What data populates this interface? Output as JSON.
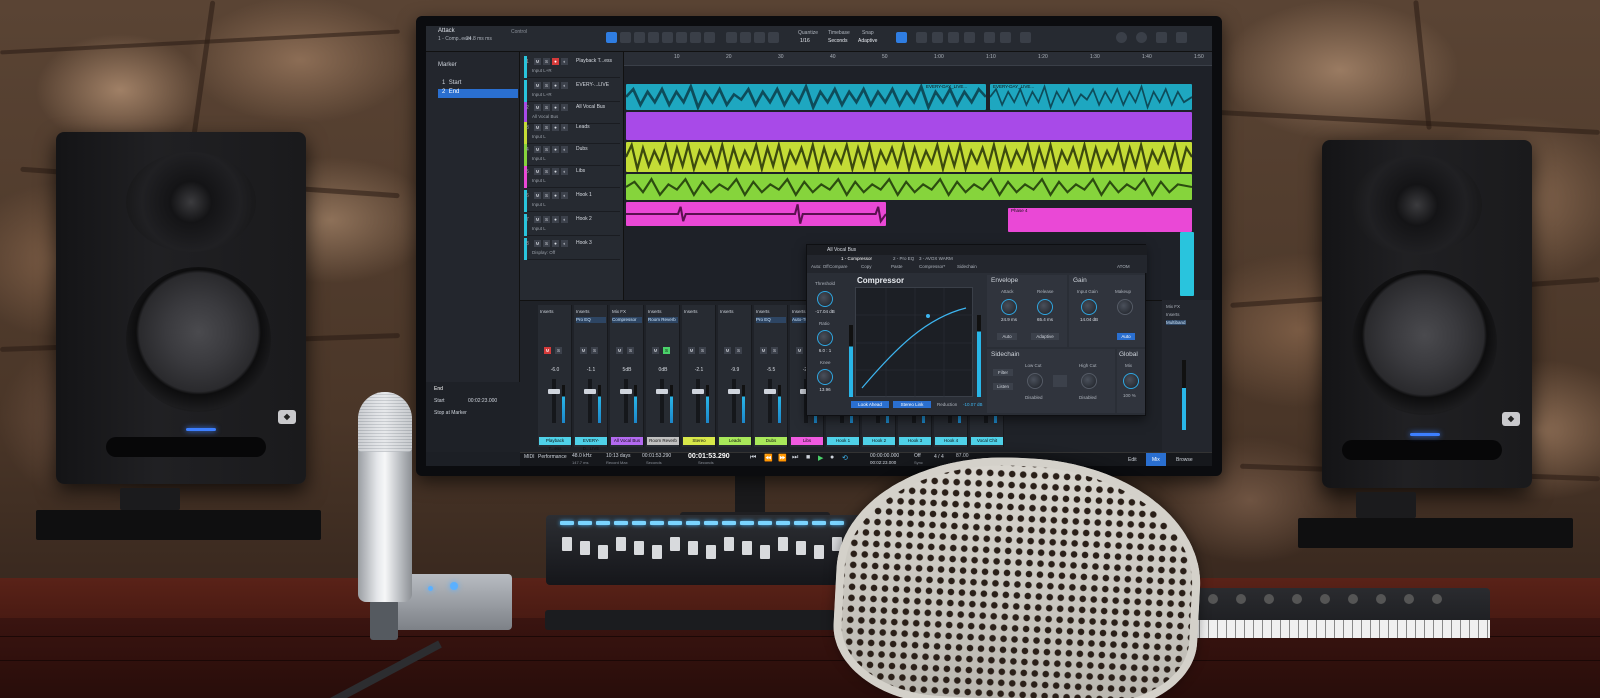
{
  "daw": {
    "song_title": "Attack",
    "song_sub": "1 - Comp..eeer",
    "song_sub2": "24.8 ms ms",
    "control_label": "Control",
    "quantize_label": "Quantize",
    "quantize_val": "1/16",
    "timebase_label": "Timebase",
    "timebase_val": "Seconds",
    "snap_label": "Snap",
    "snap_val": "Adaptive",
    "marker_title": "Marker",
    "markers": [
      {
        "num": "1",
        "name": "Start"
      },
      {
        "num": "2",
        "name": "End"
      }
    ],
    "marker_end_label": "End",
    "marker_start_label": "Start",
    "marker_start_val": "00:02:23.000",
    "stop_at_marker": "Stop at Marker",
    "ruler": [
      "10",
      "20",
      "30",
      "40",
      "50",
      "1:00",
      "1:10",
      "1:20",
      "1:30",
      "1:40",
      "1:50"
    ],
    "tracks": [
      {
        "num": "1",
        "name": "Playback T...ess",
        "input": "Input L+R"
      },
      {
        "num": "",
        "name": "EVERY-...LIVE",
        "input": "Input L+R"
      },
      {
        "num": "2",
        "name": "All Vocal Bus",
        "input": "All Vocal Bus"
      },
      {
        "num": "3",
        "name": "Leads",
        "input": "Input L"
      },
      {
        "num": "4",
        "name": "Dubs",
        "input": "Input L"
      },
      {
        "num": "5",
        "name": "Libs",
        "input": "Input L"
      },
      {
        "num": "6",
        "name": "Hook 1",
        "input": "Input L"
      },
      {
        "num": "7",
        "name": "Hook 2",
        "input": "Input L"
      },
      {
        "num": "8",
        "name": "Hook 3",
        "input": "Display: Off"
      }
    ],
    "clip_labels": [
      "EVERY-DAY_LIVE...",
      "EVERY-DAY_LIVE...",
      "Phase 4"
    ],
    "mixer_strips": [
      {
        "name": "Playback T...ess",
        "insert": "Inserts",
        "plugin": "",
        "val": "-6.0",
        "color": "#4fd1e8"
      },
      {
        "name": "EVERY-D...LIVE",
        "insert": "Inserts",
        "plugin": "Pro EQ",
        "val": "-1.1",
        "color": "#4fd1e8"
      },
      {
        "name": "All Vocal Bus",
        "insert": "Mix FX",
        "plugin": "Compressor",
        "val": "5dB",
        "color": "#b36af0"
      },
      {
        "name": "Room Reverb",
        "insert": "Inserts",
        "plugin": "Room Reverb",
        "val": "0dB",
        "color": "#c0c0c0"
      },
      {
        "name": "Stereo",
        "insert": "Inserts",
        "plugin": "",
        "val": "-2.1",
        "color": "#d8e84a"
      },
      {
        "name": "Leads",
        "insert": "Inserts",
        "plugin": "",
        "val": "-9.9",
        "color": "#a8e85a"
      },
      {
        "name": "Dubs",
        "insert": "Inserts",
        "plugin": "Pro EQ",
        "val": "-5.5",
        "color": "#a8e85a"
      },
      {
        "name": "Libs",
        "insert": "Inserts",
        "plugin": "Auto-Tune",
        "val": "-2.8",
        "color": "#f05ae0"
      },
      {
        "name": "Hook 1",
        "insert": "Inserts",
        "plugin": "Compre...",
        "val": "-6.0",
        "color": "#4fd1e8"
      },
      {
        "name": "Hook 2",
        "insert": "Inserts",
        "plugin": "",
        "val": "-3.2",
        "color": "#4fd1e8"
      },
      {
        "name": "Hook 3",
        "insert": "Inserts",
        "plugin": "",
        "val": "-4.0",
        "color": "#4fd1e8"
      },
      {
        "name": "Hook 4",
        "insert": "Inserts",
        "plugin": "",
        "val": "-2.9",
        "color": "#4fd1e8"
      },
      {
        "name": "Vocal Chit",
        "insert": "Inserts",
        "plugin": "",
        "val": "-1.5",
        "color": "#4fd1e8"
      }
    ],
    "plugin": {
      "bus": "All Vocal Bus",
      "tabs": [
        "1 - Compressor",
        "2 - Pro EQ",
        "3 - AVOX WARM"
      ],
      "sidechain_label": "Sidechain",
      "preset": "Compressor*",
      "auto_off": "Auto: Off",
      "compare": "Compare",
      "copy": "Copy",
      "paste": "Paste",
      "atom": "ATOM",
      "title": "Compressor",
      "threshold_label": "Threshold",
      "threshold_val": "-17.04 dB",
      "ratio_label": "Ratio",
      "ratio_val": "6.0 : 1",
      "knee_label": "Knee",
      "knee_val": "13.96",
      "envelope_label": "Envelope",
      "attack_label": "Attack",
      "attack_val": "24.9 ms",
      "release_label": "Release",
      "release_val": "65.4 ms",
      "auto_btn": "Auto",
      "adaptive_btn": "Adaptive",
      "gain_label": "Gain",
      "input_gain_label": "Input Gain",
      "input_gain_val": "14.04 dB",
      "makeup_label": "Makeup",
      "makeup_auto": "Auto",
      "sc_label": "Sidechain",
      "filter_btn": "Filter",
      "listen_btn": "Listen",
      "lowcut_label": "Low Cut",
      "lowcut_val": "Disabled",
      "highcut_label": "High Cut",
      "highcut_val": "Disabled",
      "global_label": "Global",
      "mix_label": "Mix",
      "mix_val": "100 %",
      "lookahead_btn": "Look Ahead",
      "stereolink_btn": "Stereo Link",
      "reduction_label": "Reduction",
      "reduction_val": "-10.07 dB"
    },
    "transport": {
      "midi": "MIDI",
      "performance": "Performance",
      "sample_rate": "48.0 kHz",
      "latency": "147.7 ms",
      "record_days": "10:13 days",
      "record_max": "Record Max",
      "pos1": "00:01:53.290",
      "pos1_unit": "Seconds",
      "time_big": "00:01:53.290",
      "time_big_unit": "Seconds",
      "loop_start": "00:00:00.000",
      "loop_end": "00:02:23.000",
      "sync": "Off",
      "sync_label": "Sync",
      "sig": "4 / 4",
      "tempo": "87.00",
      "tempo_label": "Tempo",
      "tab_edit": "Edit",
      "tab_mix": "Mix",
      "tab_browse": "Browse"
    },
    "right_mix": {
      "mix_fx": "Mix FX",
      "inserts": "Inserts",
      "plugin": "Multiband"
    }
  },
  "colors": {
    "accent": "#2a6fd0",
    "cyan_clip": "#29c4dd",
    "purple_clip": "#b04ef0",
    "yellow_clip": "#c8e23a",
    "green_clip": "#8fdc3f",
    "pink_clip": "#ee4fd8",
    "speaker_led": "#3d7fff"
  }
}
